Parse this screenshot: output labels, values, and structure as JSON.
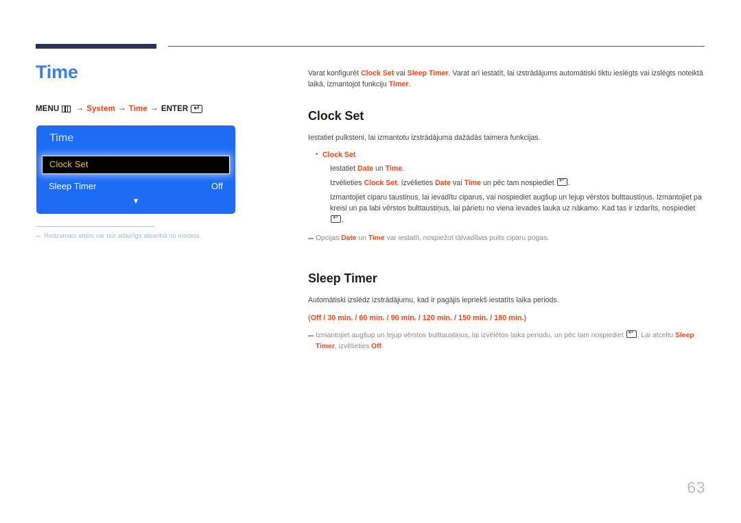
{
  "page": {
    "number": "63",
    "title": "Time"
  },
  "theme": {
    "accent_blue": "#3a7fe8",
    "accent_red": "#e8481c",
    "rule_navy": "#2e3154",
    "osd_blue": "#1d6cf5",
    "osd_highlight_text": "#f2c300",
    "body_text": "#454545",
    "note_text": "#8a8a8a",
    "pageno_color": "#bcbcbc"
  },
  "menu_path": {
    "menu_label": "MENU",
    "menu_icon": "menu-bars-icon",
    "step1": "System",
    "step2": "Time",
    "enter_label": "ENTER",
    "enter_icon": "enter-key-icon",
    "arrow": "→"
  },
  "osd": {
    "title": "Time",
    "selected_item": "Clock Set",
    "rows": [
      {
        "label": "Sleep Timer",
        "value": "Off"
      }
    ],
    "more_icon": "chevron-down-icon"
  },
  "left_footnote": {
    "text": "Redzamais attēls var būt atšķirīgs atkarībā no modeļa."
  },
  "intro": {
    "part1": "Varat konfigurēt ",
    "b1": "Clock Set",
    "part2": " vai ",
    "b2": "Sleep Timer",
    "part3": ". Varat arī iestatīt, lai izstrādājums automātiski tiktu ieslēgts vai izslēgts noteiktā laikā, izmantojot funkciju ",
    "b3": "Timer",
    "part4": "."
  },
  "clock_set": {
    "heading": "Clock Set",
    "intro": "Iestatiet pulksteni, lai izmantotu izstrādājuma dažādās taimera funkcijas.",
    "bullet_label": "Clock Set",
    "sub1_a": "Iestatiet ",
    "sub1_b1": "Date",
    "sub1_b": " un ",
    "sub1_b2": "Time",
    "sub1_c": ".",
    "sub2_a": "Izvēlieties ",
    "sub2_b1": "Clock Set",
    "sub2_b": ". Izvēlieties ",
    "sub2_b2": "Date",
    "sub2_c": " vai ",
    "sub2_b3": "Time",
    "sub2_d": " un pēc tam nospiediet ",
    "sub2_e": ".",
    "sub3_a": "Izmantojiet ciparu taustiņus, lai ievadītu ciparus, vai nospiediet augšup un lejup vērstos bulttaustiņus. Izmantojiet pa kreisi un pa labi vērstos bulttaustiņus, lai pārietu no viena ievades lauka uz nākamo. Kad tas ir izdarīts, nospiediet ",
    "sub3_b": ".",
    "note_a": "Opcijas ",
    "note_b1": "Date",
    "note_b": " un ",
    "note_b2": "Time",
    "note_c": " var iestatīt, nospiežot tālvadības pults ciparu pogas."
  },
  "sleep_timer": {
    "heading": "Sleep Timer",
    "intro": "Automātiski izslēdz izstrādājumu, kad ir pagājis iepriekš iestatīts laika periods.",
    "options_open": "(",
    "options": "Off / 30 min. / 60 min. / 90 min. / 120 min. / 150 min. / 180 min.",
    "options_close": ")",
    "note_a": "Izmantojiet augšup un lejup vērstos bulttaustiņus, lai izvēlētos laika periodu, un pēc tam nospiediet ",
    "note_b": ". Lai atceltu ",
    "note_b1": "Sleep Timer",
    "note_c": ", izvēlieties ",
    "note_b2": "Off",
    "note_d": "."
  }
}
